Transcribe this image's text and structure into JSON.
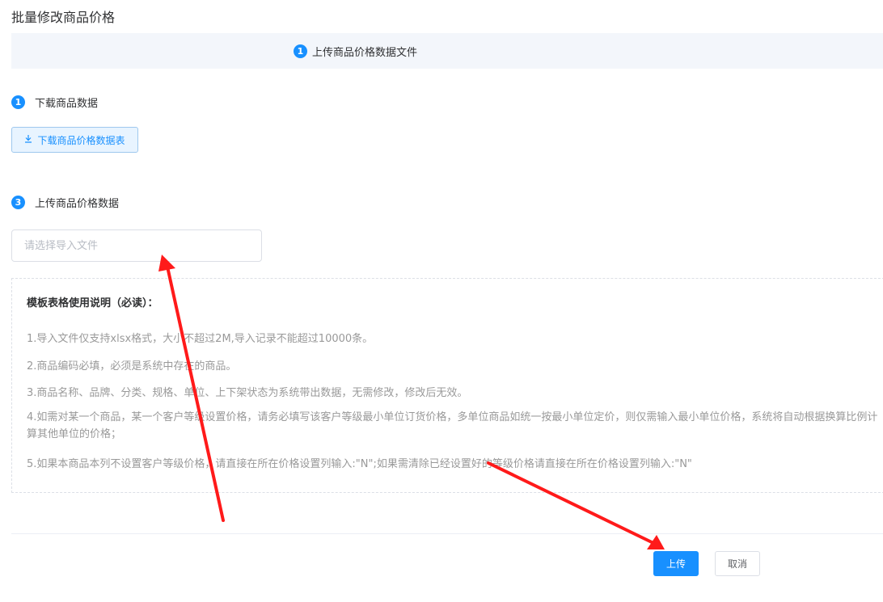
{
  "page_title": "批量修改商品价格",
  "steps_bar": {
    "step_number": "1",
    "step_label": "上传商品价格数据文件"
  },
  "section_download": {
    "number": "1",
    "title": "下载商品数据",
    "button_label": "下载商品价格数据表"
  },
  "section_upload": {
    "number": "3",
    "title": "上传商品价格数据",
    "file_input_placeholder": "请选择导入文件"
  },
  "instructions": {
    "title": "模板表格使用说明（必读）：",
    "lines": [
      "1.导入文件仅支持xlsx格式，大小不超过2M,导入记录不能超过10000条。",
      "2.商品编码必填，必须是系统中存在的商品。",
      "3.商品名称、品牌、分类、规格、单位、上下架状态为系统带出数据，无需修改，修改后无效。",
      "4.如需对某一个商品，某一个客户等级设置价格，请务必填写该客户等级最小单位订货价格，多单位商品如统一按最小单位定价，则仅需输入最小单位价格，系统将自动根据换算比例计算其他单位的价格；",
      "5.如果本商品本列不设置客户等级价格，请直接在所在价格设置列输入:\"N\";如果需清除已经设置好的等级价格请直接在所在价格设置列输入:\"N\""
    ]
  },
  "footer": {
    "upload_label": "上传",
    "cancel_label": "取消"
  },
  "colors": {
    "primary": "#1890ff",
    "annotation_arrow": "#ff1a1a"
  },
  "icons": {
    "download": "download-icon"
  }
}
